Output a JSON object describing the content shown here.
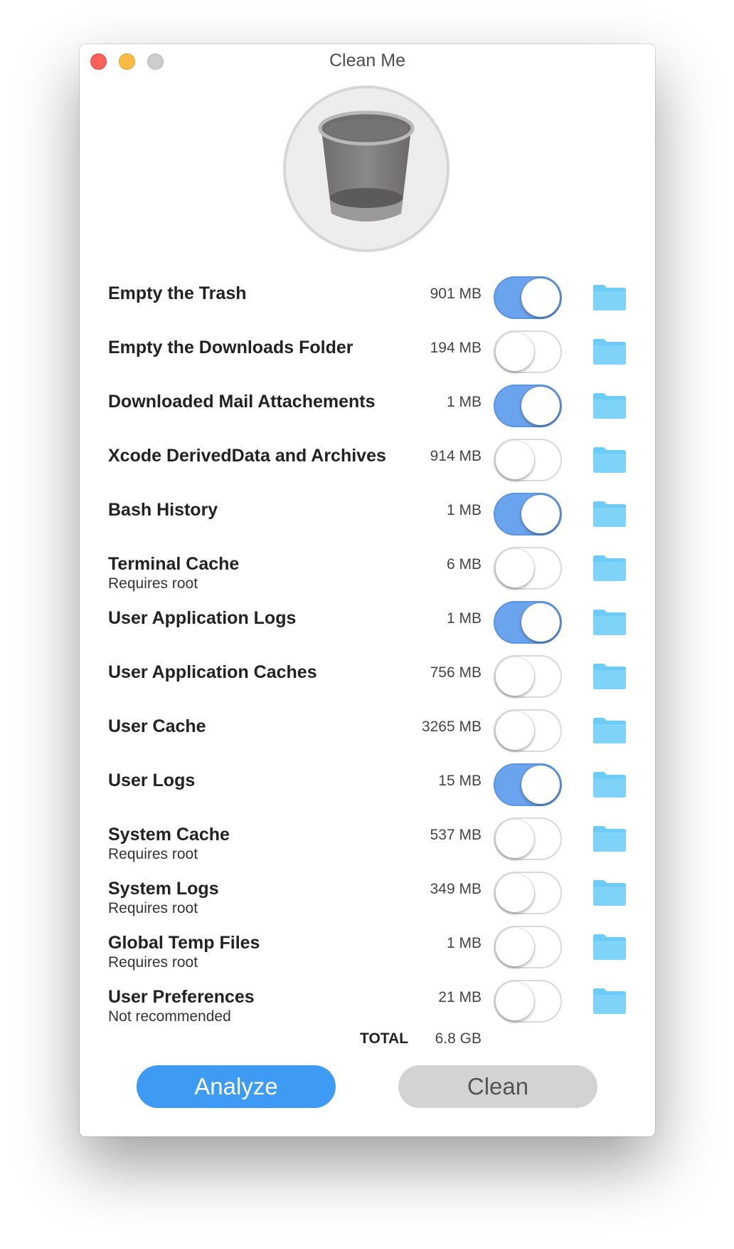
{
  "window": {
    "title": "Clean Me"
  },
  "header": {
    "icon": "trash-can-icon"
  },
  "items": [
    {
      "label": "Empty the Trash",
      "sublabel": "",
      "size": "901 MB",
      "enabled": true
    },
    {
      "label": "Empty the Downloads Folder",
      "sublabel": "",
      "size": "194 MB",
      "enabled": false
    },
    {
      "label": "Downloaded Mail Attachements",
      "sublabel": "",
      "size": "1 MB",
      "enabled": true
    },
    {
      "label": "Xcode DerivedData and Archives",
      "sublabel": "",
      "size": "914 MB",
      "enabled": false
    },
    {
      "label": "Bash History",
      "sublabel": "",
      "size": "1 MB",
      "enabled": true
    },
    {
      "label": "Terminal Cache",
      "sublabel": "Requires root",
      "size": "6 MB",
      "enabled": false
    },
    {
      "label": "User Application Logs",
      "sublabel": "",
      "size": "1 MB",
      "enabled": true
    },
    {
      "label": "User Application Caches",
      "sublabel": "",
      "size": "756 MB",
      "enabled": false
    },
    {
      "label": "User Cache",
      "sublabel": "",
      "size": "3265 MB",
      "enabled": false
    },
    {
      "label": "User Logs",
      "sublabel": "",
      "size": "15 MB",
      "enabled": true
    },
    {
      "label": "System Cache",
      "sublabel": "Requires root",
      "size": "537 MB",
      "enabled": false
    },
    {
      "label": "System Logs",
      "sublabel": "Requires root",
      "size": "349 MB",
      "enabled": false
    },
    {
      "label": "Global Temp Files",
      "sublabel": "Requires root",
      "size": "1 MB",
      "enabled": false
    },
    {
      "label": "User Preferences",
      "sublabel": "Not recommended",
      "size": "21 MB",
      "enabled": false
    }
  ],
  "total": {
    "label": "TOTAL",
    "value": "6.8 GB"
  },
  "buttons": {
    "analyze": "Analyze",
    "clean": "Clean"
  },
  "colors": {
    "toggle_on": "#6aa3ee",
    "folder": "#6ccbf7",
    "analyze_button": "#3e9bf4",
    "clean_button": "#d3d3d3"
  }
}
